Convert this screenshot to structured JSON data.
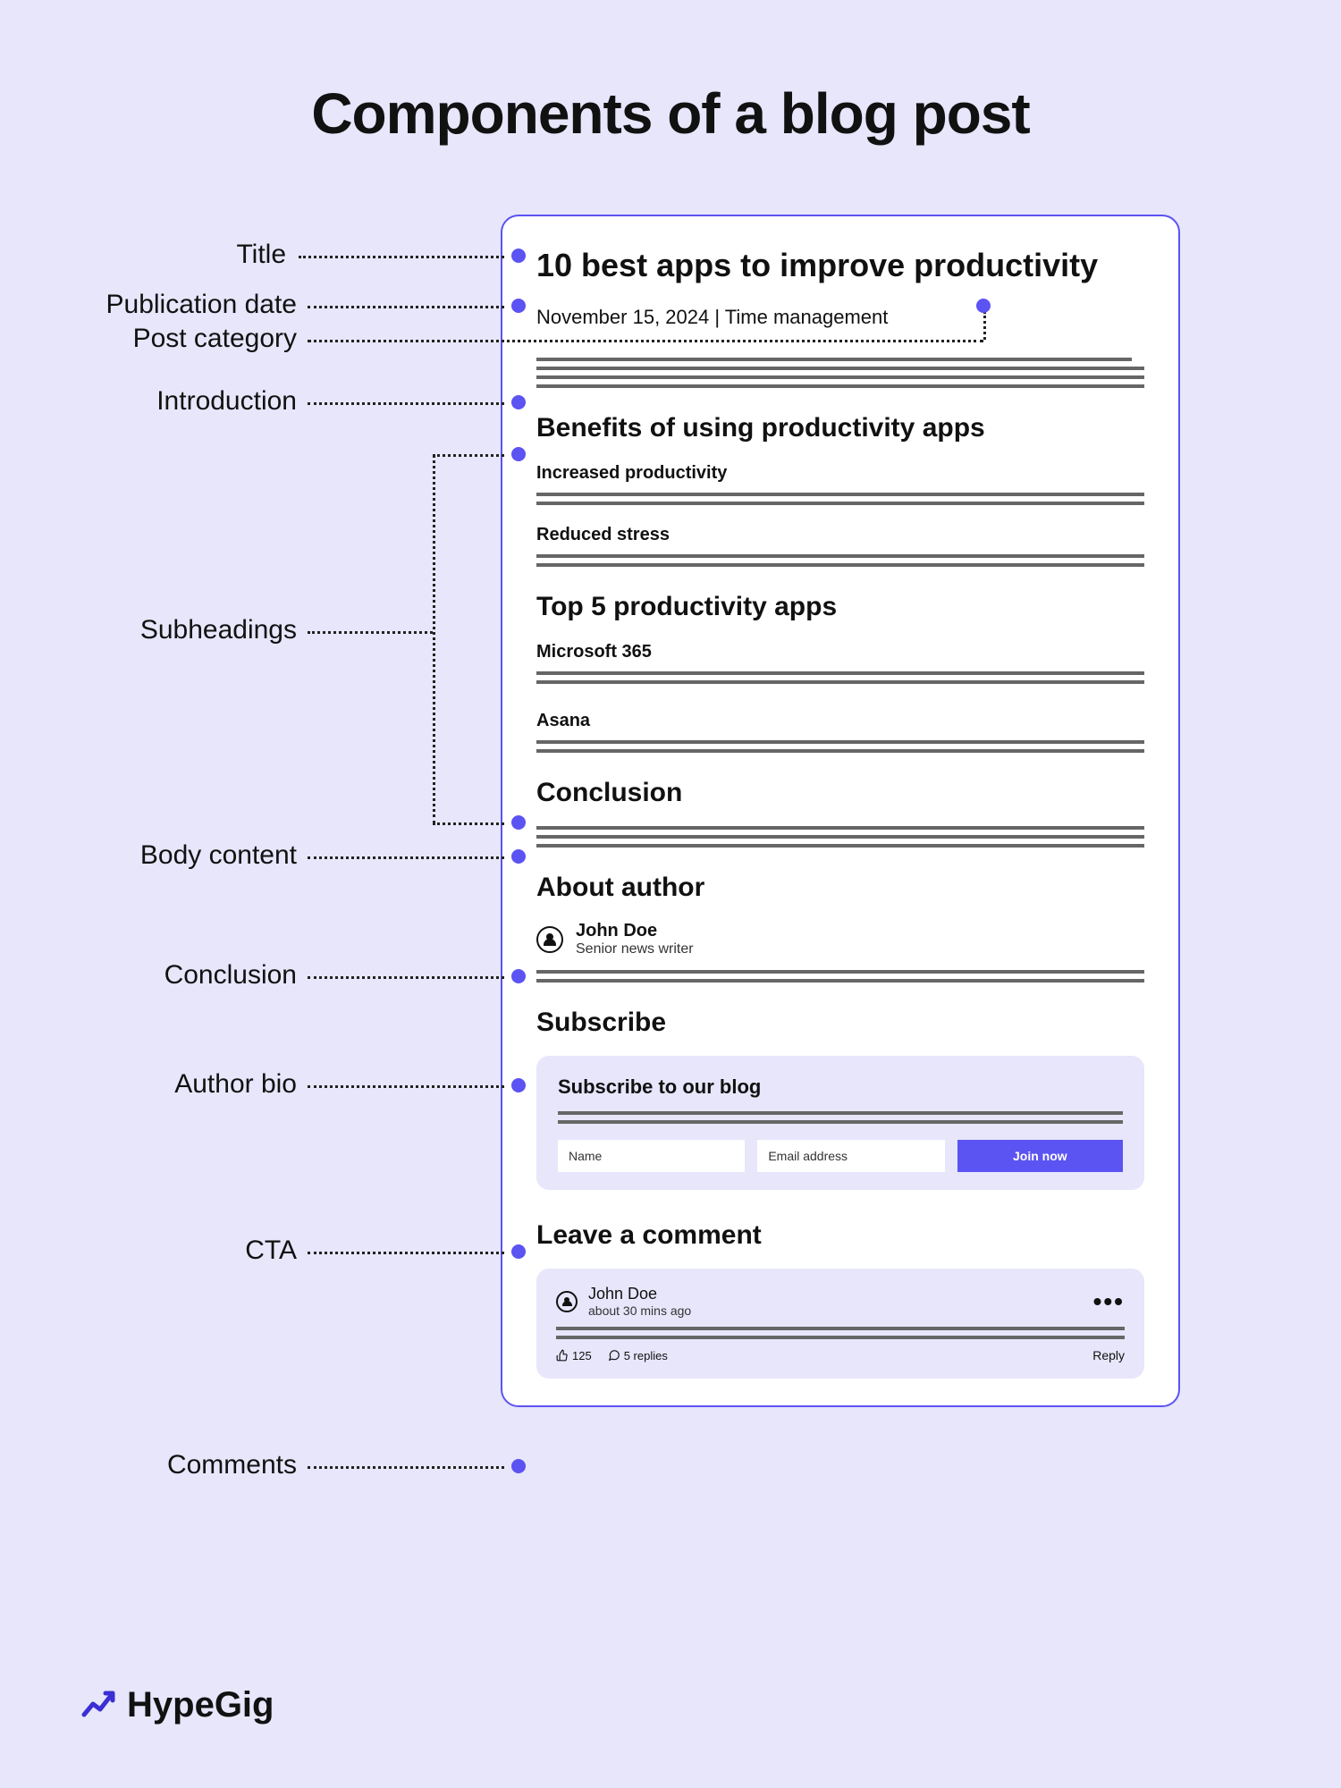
{
  "page_title": "Components of a blog post",
  "annotations": {
    "title": "Title",
    "publication_date": "Publication date",
    "post_category": "Post category",
    "introduction": "Introduction",
    "subheadings": "Subheadings",
    "body_content": "Body content",
    "conclusion": "Conclusion",
    "author_bio": "Author bio",
    "cta": "CTA",
    "comments": "Comments"
  },
  "post": {
    "title": "10 best apps to improve productivity",
    "date": "November 15, 2024",
    "category": "Time management",
    "meta_separator": " | ",
    "section_benefits": "Benefits of using productivity apps",
    "sub_increased": "Increased productivity",
    "sub_reduced": "Reduced stress",
    "section_top5": "Top 5 productivity apps",
    "app1": "Microsoft 365",
    "app2": "Asana",
    "section_conclusion": "Conclusion",
    "section_about": "About author",
    "author_name": "John Doe",
    "author_role": "Senior news writer",
    "section_subscribe": "Subscribe",
    "subscribe_heading": "Subscribe to our blog",
    "name_placeholder": "Name",
    "email_placeholder": "Email address",
    "join_button": "Join now",
    "section_comment": "Leave a comment",
    "comment_name": "John Doe",
    "comment_time": "about 30 mins ago",
    "likes_count": "125",
    "replies_count": "5 replies",
    "reply_label": "Reply"
  },
  "brand": "HypeGig"
}
